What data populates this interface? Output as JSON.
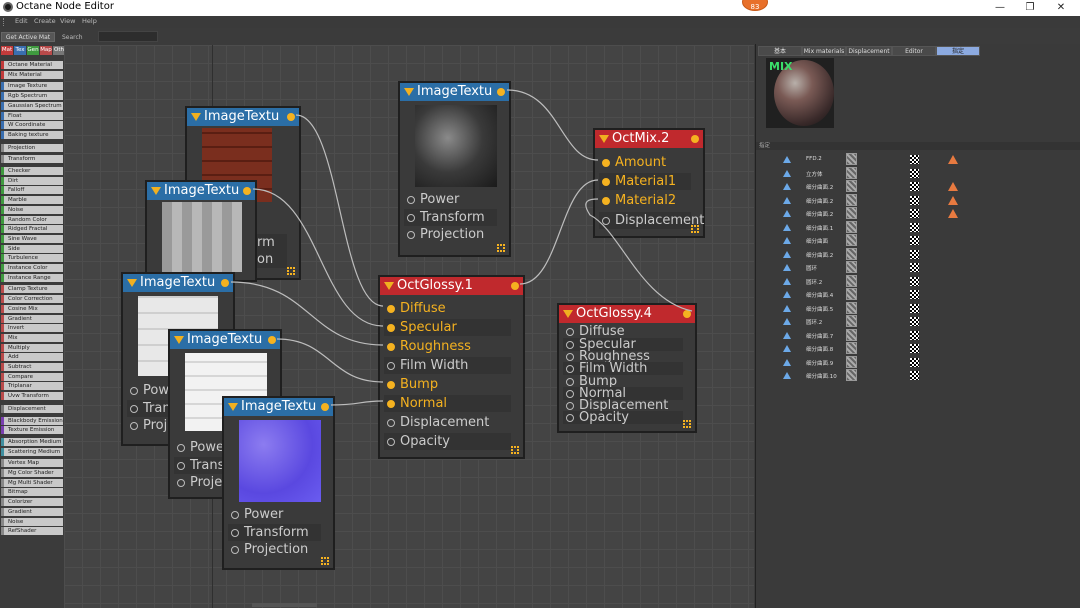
{
  "window": {
    "title": "Octane Node Editor",
    "minimize": "—",
    "maximize": "❐",
    "close": "✕",
    "badge": "83"
  },
  "menu": {
    "edit": "Edit",
    "create": "Create",
    "view": "View",
    "help": "Help"
  },
  "toolbar": {
    "get_active_mat": "Get Active Mat",
    "search_label": "Search",
    "search_value": ""
  },
  "categories": [
    {
      "label": "Mat",
      "color": "#c23b3b"
    },
    {
      "label": "Tex",
      "color": "#3a6fb0"
    },
    {
      "label": "Gen",
      "color": "#3f9a3f"
    },
    {
      "label": "Map",
      "color": "#b94a4a"
    },
    {
      "label": "Oth",
      "color": "#777777"
    },
    {
      "label": "Ems",
      "color": "#7a3fb0"
    },
    {
      "label": "Med",
      "color": "#3f8fa0"
    },
    {
      "label": "C4D",
      "color": "#888888"
    }
  ],
  "sidebar": [
    {
      "label": "Octane Material",
      "accent": "#c23b3b"
    },
    {
      "label": "Mix Material",
      "accent": "#c23b3b"
    },
    {
      "label": "Image Texture",
      "accent": "#3a6fb0"
    },
    {
      "label": "Rgb Spectrum",
      "accent": "#3a6fb0"
    },
    {
      "label": "Gaussian Spectrum",
      "accent": "#3a6fb0"
    },
    {
      "label": "Float",
      "accent": "#3a6fb0"
    },
    {
      "label": "W Coordinate",
      "accent": "#3a6fb0"
    },
    {
      "label": "Baking texture",
      "accent": "#3a6fb0"
    },
    {
      "label": "Projection",
      "accent": "#888888"
    },
    {
      "label": "Transform",
      "accent": "#888888"
    },
    {
      "label": "Checker",
      "accent": "#3f9a3f"
    },
    {
      "label": "Dirt",
      "accent": "#3f9a3f"
    },
    {
      "label": "Falloff",
      "accent": "#3f9a3f"
    },
    {
      "label": "Marble",
      "accent": "#3f9a3f"
    },
    {
      "label": "Noise",
      "accent": "#3f9a3f"
    },
    {
      "label": "Random Color",
      "accent": "#3f9a3f"
    },
    {
      "label": "Ridged Fractal",
      "accent": "#3f9a3f"
    },
    {
      "label": "Sine Wave",
      "accent": "#3f9a3f"
    },
    {
      "label": "Side",
      "accent": "#3f9a3f"
    },
    {
      "label": "Turbulence",
      "accent": "#3f9a3f"
    },
    {
      "label": "Instance Color",
      "accent": "#3f9a3f"
    },
    {
      "label": "Instance Range",
      "accent": "#3f9a3f"
    },
    {
      "label": "Clamp Texture",
      "accent": "#b94a4a"
    },
    {
      "label": "Color Correction",
      "accent": "#b94a4a"
    },
    {
      "label": "Cosine Mix",
      "accent": "#b94a4a"
    },
    {
      "label": "Gradient",
      "accent": "#b94a4a"
    },
    {
      "label": "Invert",
      "accent": "#b94a4a"
    },
    {
      "label": "Mix",
      "accent": "#b94a4a"
    },
    {
      "label": "Multiply",
      "accent": "#b94a4a"
    },
    {
      "label": "Add",
      "accent": "#b94a4a"
    },
    {
      "label": "Subtract",
      "accent": "#b94a4a"
    },
    {
      "label": "Compare",
      "accent": "#b94a4a"
    },
    {
      "label": "Triplanar",
      "accent": "#b94a4a"
    },
    {
      "label": "Uvw Transform",
      "accent": "#b94a4a"
    },
    {
      "label": "Displacement",
      "accent": "#777777"
    },
    {
      "label": "Blackbody Emission",
      "accent": "#7a3fb0"
    },
    {
      "label": "Texture Emission",
      "accent": "#7a3fb0"
    },
    {
      "label": "Absorption Medium",
      "accent": "#3f8fa0"
    },
    {
      "label": "Scattering Medium",
      "accent": "#3f8fa0"
    },
    {
      "label": "Vertex Map",
      "accent": "#888888"
    },
    {
      "label": "Mg Color Shader",
      "accent": "#888888"
    },
    {
      "label": "Mg Multi Shader",
      "accent": "#888888"
    },
    {
      "label": "Bitmap",
      "accent": "#888888"
    },
    {
      "label": "Colorizer",
      "accent": "#888888"
    },
    {
      "label": "Gradient",
      "accent": "#888888"
    },
    {
      "label": "Noise",
      "accent": "#888888"
    },
    {
      "label": "RefShader",
      "accent": "#888888"
    }
  ],
  "nodes": {
    "img1": {
      "title": "ImageTextu",
      "ports": [
        "Power",
        "Transform",
        "Projection"
      ]
    },
    "img2": {
      "title": "ImageTextu",
      "partial": [
        "rm",
        "on"
      ]
    },
    "img3": {
      "title": "ImageTextu"
    },
    "img4": {
      "title": "ImageTextu",
      "ports": [
        "Powe",
        "Trans",
        "Proje"
      ]
    },
    "img5": {
      "title": "ImageTextu",
      "ports": [
        "Power",
        "Transf",
        "Projec"
      ]
    },
    "img6": {
      "title": "ImageTextu",
      "ports": [
        "Power",
        "Transform",
        "Projection"
      ]
    },
    "glossy1": {
      "title": "OctGlossy.1",
      "ports": [
        "Diffuse",
        "Specular",
        "Roughness",
        "Film Width",
        "Bump",
        "Normal",
        "Displacement",
        "Opacity"
      ]
    },
    "glossy4": {
      "title": "OctGlossy.4",
      "ports": [
        "Diffuse",
        "Specular",
        "Roughness",
        "Film Width",
        "Bump",
        "Normal",
        "Displacement",
        "Opacity"
      ]
    },
    "mix": {
      "title": "OctMix.2",
      "ports": [
        "Amount",
        "Material1",
        "Material2",
        "Displacement"
      ]
    }
  },
  "right_panel": {
    "tabs": [
      "基本",
      "Mix materials",
      "Displacement",
      "Editor",
      "指定"
    ],
    "preview_label": "MIX",
    "assign_header": "指定",
    "objects": [
      "FFD.2",
      "立方体",
      "细分曲面.2",
      "细分曲面.2",
      "细分曲面.2",
      "细分曲面.1",
      "细分曲面",
      "细分曲面.2",
      "圆环",
      "圆环.2",
      "细分曲面.4",
      "细分曲面.5",
      "圆环.2",
      "细分曲面.7",
      "细分曲面.8",
      "细分曲面.9",
      "细分曲面.10"
    ],
    "warnings": [
      true,
      false,
      true,
      true,
      true,
      false,
      false,
      false,
      false,
      false,
      false,
      false,
      false,
      false,
      false,
      false,
      false
    ]
  }
}
